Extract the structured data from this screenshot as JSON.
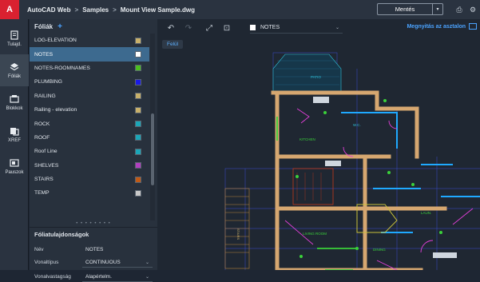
{
  "app": {
    "logo_letter": "A"
  },
  "breadcrumb": {
    "root": "AutoCAD Web",
    "folder": "Samples",
    "file": "Mount View Sample.dwg",
    "separator": ">"
  },
  "toolbar": {
    "save_label": "Mentés",
    "save_dropdown": "▾",
    "print_icon": "⎙",
    "settings_icon": "⚙"
  },
  "rail": {
    "items": [
      {
        "label": "Tulajd.",
        "icon": "properties-icon"
      },
      {
        "label": "Fóliák",
        "icon": "layers-icon"
      },
      {
        "label": "Blokkok",
        "icon": "blocks-icon"
      },
      {
        "label": "XREF",
        "icon": "xref-icon"
      },
      {
        "label": "Pauszok",
        "icon": "underlays-icon"
      }
    ]
  },
  "layers_panel": {
    "title": "Fóliák",
    "add_label": "+",
    "layers": [
      {
        "name": "LOG-ELEVATION",
        "color": "#c8b06a"
      },
      {
        "name": "NOTES",
        "color": "#ffffff",
        "selected": true
      },
      {
        "name": "NOTES-ROOMNAMES",
        "color": "#4bbf1f"
      },
      {
        "name": "PLUMBING",
        "color": "#1a1ae6"
      },
      {
        "name": "RAILING",
        "color": "#c8b06a"
      },
      {
        "name": "Railing - elevation",
        "color": "#c8b06a"
      },
      {
        "name": "ROCK",
        "color": "#1ba6b8"
      },
      {
        "name": "ROOF",
        "color": "#1ba6b8"
      },
      {
        "name": "Roof Line",
        "color": "#1ba6b8"
      },
      {
        "name": "SHELVES",
        "color": "#b23fc0"
      },
      {
        "name": "STAIRS",
        "color": "#c05a16"
      },
      {
        "name": "TEMP",
        "color": "#c8c8c8"
      }
    ],
    "grip": "• • • • • • • •"
  },
  "properties": {
    "title": "Fóliatulajdonságok",
    "rows": [
      {
        "label": "Név",
        "value": "NOTES"
      },
      {
        "label": "Vonaltípus",
        "value": "CONTINUOUS"
      },
      {
        "label": "Vonalvastagság",
        "value": "Alapértelm."
      }
    ]
  },
  "canvas": {
    "current_layer": "NOTES",
    "share_label": "Megnyitás az asztalon",
    "view_tab": "Felül",
    "room_labels": [
      "PATIO",
      "KITCHEN",
      "LIVING ROOM",
      "DINING",
      "STAIRS",
      "W.C.",
      "LAUN."
    ]
  },
  "colors": {
    "accent": "#4ba3ff",
    "selected_row": "#3d6a8f",
    "brand": "#d92130"
  }
}
